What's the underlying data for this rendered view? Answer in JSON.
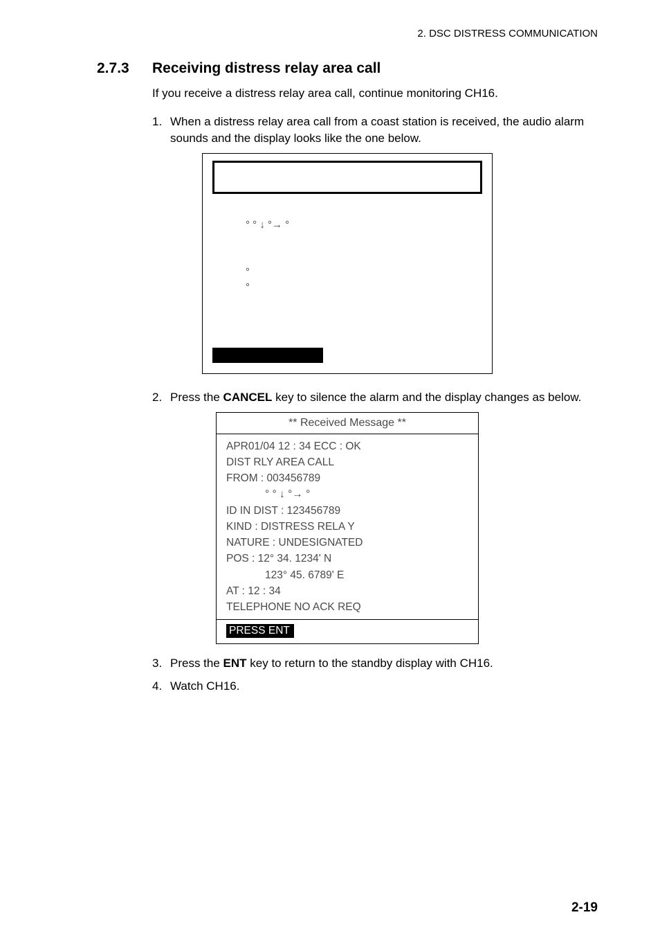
{
  "running_header": "2. DSC DISTRESS COMMUNICATION",
  "section": {
    "number": "2.7.3",
    "title": "Receiving distress relay area call"
  },
  "intro": "If you receive a distress relay area call, continue monitoring CH16.",
  "step1": {
    "num": "1.",
    "text": "When a distress relay area call from a coast station is received, the audio alarm sounds and the display looks like the one below."
  },
  "lcd1": {
    "row_arrows": "°          °   ↓    °→    °",
    "row_deg1": "°",
    "row_deg2": "°"
  },
  "step2": {
    "num": "2.",
    "text_before": "Press the ",
    "key": "CANCEL",
    "text_after": " key to silence the alarm and the display changes as below."
  },
  "lcd2": {
    "title": "** Received Message **",
    "line1": "APR01/04 12 : 34    ECC : OK",
    "line2": "DIST RLY AREA CALL",
    "line3": "FROM : 003456789",
    "line4": "°          °   ↓    °→     °",
    "line5": "ID IN DIST : 123456789",
    "line6": "KIND : DISTRESS RELA Y",
    "line7": "NATURE : UNDESIGNATED",
    "line8": "POS :   12° 34. 1234' N",
    "line9": "123° 45. 6789' E",
    "line10": "AT : 12 : 34",
    "line11": "TELEPHONE    NO ACK REQ",
    "footer": "PRESS ENT"
  },
  "step3": {
    "num": "3.",
    "text_before": "Press the ",
    "key": "ENT",
    "text_after": " key to return to the standby display with CH16."
  },
  "step4": {
    "num": "4.",
    "text": "Watch CH16."
  },
  "page_number": "2-19"
}
